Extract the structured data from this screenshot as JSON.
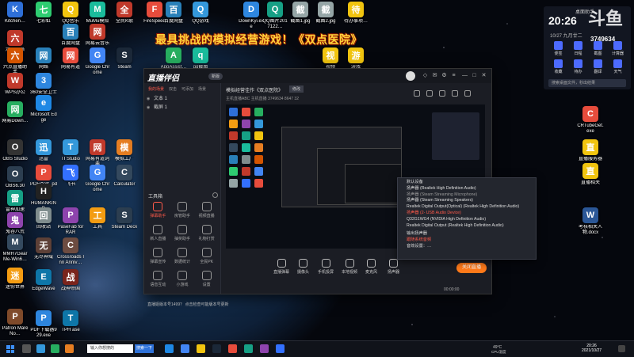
{
  "banner": "最具挑战的模拟经营游戏！《双点医院》",
  "desktop_icons": [
    {
      "label": "Kitchen…",
      "color": "#2e6fd8",
      "glyph": "K"
    },
    {
      "label": "六点网络",
      "color": "#c0392b",
      "glyph": "六"
    },
    {
      "label": "六点直播助手",
      "color": "#d35400",
      "glyph": "六"
    },
    {
      "label": "WPS办公",
      "color": "#c0392b",
      "glyph": "W"
    },
    {
      "label": "网易Down…",
      "color": "#27ae60",
      "glyph": "网"
    },
    {
      "label": "OBS Studio",
      "color": "#333333",
      "glyph": "O"
    },
    {
      "label": "OBS6.30",
      "color": "#2c3e50",
      "glyph": "O"
    },
    {
      "label": "雷神加速",
      "color": "#16a085",
      "glyph": "雷"
    },
    {
      "label": "鬼谷八荒",
      "color": "#8e44ad",
      "glyph": "鬼"
    },
    {
      "label": "MMH7GearMe-Win6…",
      "color": "#34495e",
      "glyph": "M"
    },
    {
      "label": "迷你世界",
      "color": "#f39c12",
      "glyph": "迷"
    },
    {
      "label": "Patron Mare No…",
      "color": "#7f4a2a",
      "glyph": "P"
    },
    {
      "label": "七彩虹",
      "color": "#2ecc71",
      "glyph": "七"
    },
    {
      "label": "网络",
      "color": "#2980b9",
      "glyph": "网"
    },
    {
      "label": "360安全卫士",
      "color": "#2e86de",
      "glyph": "3"
    },
    {
      "label": "Microsoft Edge",
      "color": "#1e88e5",
      "glyph": "e"
    },
    {
      "label": "迅雷",
      "color": "#3498db",
      "glyph": "迅"
    },
    {
      "label": "PDF阅读_pdf",
      "color": "#e74c3c",
      "glyph": "P"
    },
    {
      "label": "HUMANKIND",
      "color": "#222222",
      "glyph": "H"
    },
    {
      "label": "回收站",
      "color": "#7f8c8d",
      "glyph": "回"
    },
    {
      "label": "无尽神域",
      "color": "#5d4037",
      "glyph": "无"
    },
    {
      "label": "EdgeWave",
      "color": "#0e76a8",
      "glyph": "E"
    },
    {
      "label": "PDF下载器929.exe",
      "color": "#2e86de",
      "glyph": "P"
    },
    {
      "label": "QQ音乐",
      "color": "#f1c40f",
      "glyph": "Q"
    },
    {
      "label": "百度网盘",
      "color": "#2980b9",
      "glyph": "百"
    },
    {
      "label": "网易有道",
      "color": "#e74c3c",
      "glyph": "网"
    },
    {
      "label": "TI Studio",
      "color": "#3498db",
      "glyph": "T"
    },
    {
      "label": "飞书",
      "color": "#3370ff",
      "glyph": "飞"
    },
    {
      "label": "PaseFab for RAR",
      "color": "#8e44ad",
      "glyph": "P"
    },
    {
      "label": "Crossroads Inn Anniv…",
      "color": "#6d4c41",
      "glyph": "C"
    },
    {
      "label": "战神帝国",
      "color": "#7b241c",
      "glyph": "战"
    },
    {
      "label": "TPH ase",
      "color": "#0e76a8",
      "glyph": "T"
    },
    {
      "label": "MuMu模拟器",
      "color": "#1abc9c",
      "glyph": "M"
    },
    {
      "label": "网易云音乐",
      "color": "#c0392b",
      "glyph": "网"
    },
    {
      "label": "Google Chrome",
      "color": "#4285f4",
      "glyph": "G"
    },
    {
      "label": "网易有道词典",
      "color": "#c0392b",
      "glyph": "网"
    },
    {
      "label": "Google Chrome",
      "color": "#4285f4",
      "glyph": "G"
    },
    {
      "label": "工具",
      "color": "#f39c12",
      "glyph": "工"
    },
    {
      "label": "全民K歌",
      "color": "#c0392b",
      "glyph": "全"
    },
    {
      "label": "Steam",
      "color": "#1b2838",
      "glyph": "S"
    },
    {
      "label": "模拟工厂",
      "color": "#e67e22",
      "glyph": "模"
    },
    {
      "label": "Calculator",
      "color": "#34495e",
      "glyph": "C"
    },
    {
      "label": "Steam Deck",
      "color": "#2c3e50",
      "glyph": "S"
    },
    {
      "label": "FireSpeed",
      "color": "#e74c3c",
      "glyph": "F"
    },
    {
      "label": "百度网盘",
      "color": "#2980b9",
      "glyph": "百"
    },
    {
      "label": "AppAssist…",
      "color": "#27ae60",
      "glyph": "A"
    },
    {
      "label": "QQ游戏",
      "color": "#3498db",
      "glyph": "Q"
    },
    {
      "label": "qq截图",
      "color": "#1abc9c",
      "glyph": "q"
    },
    {
      "label": "DownKyi.exe",
      "color": "#2e86de",
      "glyph": "D"
    },
    {
      "label": "QQ图片2017122…",
      "color": "#16a085",
      "glyph": "Q"
    },
    {
      "label": "截图1.jpg",
      "color": "#95a5a6",
      "glyph": "截"
    },
    {
      "label": "截图2.jpg",
      "color": "#95a5a6",
      "glyph": "截"
    },
    {
      "label": "待办事项…",
      "color": "#f1c40f",
      "glyph": "待"
    },
    {
      "label": "游戏",
      "color": "#f1c40f",
      "glyph": "游"
    },
    {
      "label": "视频",
      "color": "#f1c40f",
      "glyph": "视"
    },
    {
      "label": "CRTubeGet.exe",
      "color": "#e74c3c",
      "glyph": "C"
    },
    {
      "label": "直播服务器",
      "color": "#f1c40f",
      "glyph": "直"
    },
    {
      "label": "直播相关",
      "color": "#f1c40f",
      "glyph": "直"
    },
    {
      "label": "考核相关人物.docx",
      "color": "#2b5797",
      "glyph": "W"
    }
  ],
  "clock_widget": {
    "time": "20:26",
    "date": "10/27 九月廿二",
    "top_label": "桌面助手",
    "quick": [
      "便签",
      "日程",
      "截图",
      "计算器",
      "收藏",
      "待办",
      "翻译",
      "天气"
    ],
    "search": "搜索桌面文件，秒出结果"
  },
  "watermark": {
    "text": "斗鱼",
    "room": "3749634"
  },
  "app": {
    "logo": "直播伴侣",
    "badge": "新版",
    "window_controls": [
      "—",
      "□",
      "✕"
    ],
    "scene_tabs": [
      "我的场景",
      "双击",
      "可添加",
      "场景"
    ],
    "sources": [
      "文本 1",
      "截屏 1"
    ],
    "tools_title": "工具箱",
    "tools": [
      {
        "label": "弹幕助手",
        "active": true
      },
      {
        "label": "房管助手",
        "active": false
      },
      {
        "label": "视频直播",
        "active": false
      },
      {
        "label": "新人直播",
        "active": false
      },
      {
        "label": "抽奖助手",
        "active": false
      },
      {
        "label": "礼物打赏",
        "active": false
      },
      {
        "label": "弹幕宣传",
        "active": false
      },
      {
        "label": "数据统计",
        "active": false
      },
      {
        "label": "全民PK",
        "active": false
      },
      {
        "label": "语音互动",
        "active": false
      },
      {
        "label": "小游戏",
        "active": false
      },
      {
        "label": "设置",
        "active": false
      }
    ],
    "status_left": "直播姬版本号1499？ 点击检查可能版本号更新",
    "title": "模拟经营佳作《双点医院》",
    "title_tag": "修改",
    "sub": "主机直播ABC  主机直播  3749634  8647  32",
    "bottom": [
      "直播弹幕",
      "摄像头",
      "手机投屏",
      "本地视频",
      "麦克风",
      "扬声器"
    ],
    "live_button": "关闭直播",
    "status_right": "00:00:00"
  },
  "dropdown": {
    "items": [
      {
        "text": "默认设备",
        "style": "normal"
      },
      {
        "text": "扬声器 (Realtek High Definition Audio)",
        "style": "normal"
      },
      {
        "text": "扬声器 (Steam Streaming Microphone)",
        "style": "hov"
      },
      {
        "text": "扬声器 (Steam Streaming Speakers)",
        "style": "normal"
      },
      {
        "text": "Realtek Digital Output(Optical) (Realtek High Definition Audio)",
        "style": "normal"
      },
      {
        "text": "扬声器 (2- USB Audio Device)",
        "style": "active"
      },
      {
        "text": "Q32G1WG4 (NVIDIA High Definition Audio)",
        "style": "normal"
      },
      {
        "text": "Realtek Digital Output (Realtek High Definition Audio)",
        "style": "normal"
      },
      {
        "text": "输出扬声器",
        "style": "sep"
      },
      {
        "text": "跟随系统音频",
        "style": "active"
      },
      {
        "text": "音效设置：…",
        "style": "normal"
      }
    ]
  },
  "taskbar": {
    "search_placeholder": "输入你想搜的",
    "search_button": "搜索一下",
    "temp": "49°C",
    "temp_label": "CPU温度",
    "time": "20:26",
    "date": "2021/10/27"
  }
}
